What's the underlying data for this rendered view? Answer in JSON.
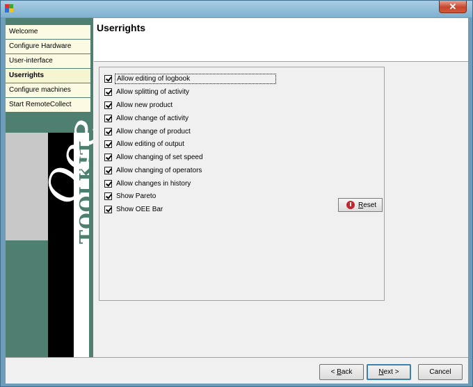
{
  "window": {
    "title": "",
    "close_label": "✕",
    "close_color": "#c7462d"
  },
  "nav": {
    "items": [
      {
        "label": "Welcome",
        "active": false
      },
      {
        "label": "Configure Hardware",
        "active": false
      },
      {
        "label": "User-interface",
        "active": false
      },
      {
        "label": "Userrights",
        "active": true
      },
      {
        "label": "Configure machines",
        "active": false
      },
      {
        "label": "Start RemoteCollect",
        "active": false
      }
    ]
  },
  "brand": {
    "word": "TOOLKIT",
    "script": "Oee",
    "accent_color": "#4e7f70"
  },
  "header": {
    "title": "Userrights"
  },
  "options": [
    {
      "label": "Allow editing of logbook",
      "checked": true
    },
    {
      "label": "Allow splitting of activity",
      "checked": true
    },
    {
      "label": "Allow new product",
      "checked": true
    },
    {
      "label": "Allow change of activity",
      "checked": true
    },
    {
      "label": "Allow change of product",
      "checked": true
    },
    {
      "label": "Allow editing of output",
      "checked": true
    },
    {
      "label": "Allow changing of set speed",
      "checked": true
    },
    {
      "label": "Allow changing of operators",
      "checked": true
    },
    {
      "label": "Allow changes in history",
      "checked": true
    },
    {
      "label": "Show Pareto",
      "checked": true
    },
    {
      "label": "Show OEE Bar",
      "checked": true
    }
  ],
  "reset": {
    "mnemonic": "R",
    "rest": "eset",
    "icon": "reset-icon"
  },
  "footer": {
    "back_prefix": "< ",
    "back_mnemonic": "B",
    "back_rest": "ack",
    "next_mnemonic": "N",
    "next_rest": "ext >",
    "cancel_label": "Cancel"
  }
}
